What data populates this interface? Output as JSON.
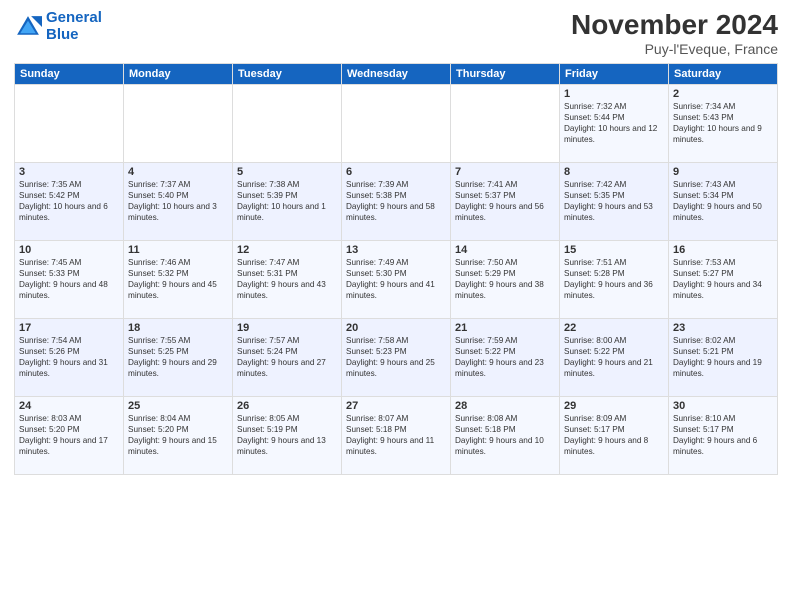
{
  "logo": {
    "line1": "General",
    "line2": "Blue"
  },
  "title": "November 2024",
  "subtitle": "Puy-l'Eveque, France",
  "days_of_week": [
    "Sunday",
    "Monday",
    "Tuesday",
    "Wednesday",
    "Thursday",
    "Friday",
    "Saturday"
  ],
  "weeks": [
    [
      {
        "day": "",
        "detail": ""
      },
      {
        "day": "",
        "detail": ""
      },
      {
        "day": "",
        "detail": ""
      },
      {
        "day": "",
        "detail": ""
      },
      {
        "day": "",
        "detail": ""
      },
      {
        "day": "1",
        "detail": "Sunrise: 7:32 AM\nSunset: 5:44 PM\nDaylight: 10 hours and 12 minutes."
      },
      {
        "day": "2",
        "detail": "Sunrise: 7:34 AM\nSunset: 5:43 PM\nDaylight: 10 hours and 9 minutes."
      }
    ],
    [
      {
        "day": "3",
        "detail": "Sunrise: 7:35 AM\nSunset: 5:42 PM\nDaylight: 10 hours and 6 minutes."
      },
      {
        "day": "4",
        "detail": "Sunrise: 7:37 AM\nSunset: 5:40 PM\nDaylight: 10 hours and 3 minutes."
      },
      {
        "day": "5",
        "detail": "Sunrise: 7:38 AM\nSunset: 5:39 PM\nDaylight: 10 hours and 1 minute."
      },
      {
        "day": "6",
        "detail": "Sunrise: 7:39 AM\nSunset: 5:38 PM\nDaylight: 9 hours and 58 minutes."
      },
      {
        "day": "7",
        "detail": "Sunrise: 7:41 AM\nSunset: 5:37 PM\nDaylight: 9 hours and 56 minutes."
      },
      {
        "day": "8",
        "detail": "Sunrise: 7:42 AM\nSunset: 5:35 PM\nDaylight: 9 hours and 53 minutes."
      },
      {
        "day": "9",
        "detail": "Sunrise: 7:43 AM\nSunset: 5:34 PM\nDaylight: 9 hours and 50 minutes."
      }
    ],
    [
      {
        "day": "10",
        "detail": "Sunrise: 7:45 AM\nSunset: 5:33 PM\nDaylight: 9 hours and 48 minutes."
      },
      {
        "day": "11",
        "detail": "Sunrise: 7:46 AM\nSunset: 5:32 PM\nDaylight: 9 hours and 45 minutes."
      },
      {
        "day": "12",
        "detail": "Sunrise: 7:47 AM\nSunset: 5:31 PM\nDaylight: 9 hours and 43 minutes."
      },
      {
        "day": "13",
        "detail": "Sunrise: 7:49 AM\nSunset: 5:30 PM\nDaylight: 9 hours and 41 minutes."
      },
      {
        "day": "14",
        "detail": "Sunrise: 7:50 AM\nSunset: 5:29 PM\nDaylight: 9 hours and 38 minutes."
      },
      {
        "day": "15",
        "detail": "Sunrise: 7:51 AM\nSunset: 5:28 PM\nDaylight: 9 hours and 36 minutes."
      },
      {
        "day": "16",
        "detail": "Sunrise: 7:53 AM\nSunset: 5:27 PM\nDaylight: 9 hours and 34 minutes."
      }
    ],
    [
      {
        "day": "17",
        "detail": "Sunrise: 7:54 AM\nSunset: 5:26 PM\nDaylight: 9 hours and 31 minutes."
      },
      {
        "day": "18",
        "detail": "Sunrise: 7:55 AM\nSunset: 5:25 PM\nDaylight: 9 hours and 29 minutes."
      },
      {
        "day": "19",
        "detail": "Sunrise: 7:57 AM\nSunset: 5:24 PM\nDaylight: 9 hours and 27 minutes."
      },
      {
        "day": "20",
        "detail": "Sunrise: 7:58 AM\nSunset: 5:23 PM\nDaylight: 9 hours and 25 minutes."
      },
      {
        "day": "21",
        "detail": "Sunrise: 7:59 AM\nSunset: 5:22 PM\nDaylight: 9 hours and 23 minutes."
      },
      {
        "day": "22",
        "detail": "Sunrise: 8:00 AM\nSunset: 5:22 PM\nDaylight: 9 hours and 21 minutes."
      },
      {
        "day": "23",
        "detail": "Sunrise: 8:02 AM\nSunset: 5:21 PM\nDaylight: 9 hours and 19 minutes."
      }
    ],
    [
      {
        "day": "24",
        "detail": "Sunrise: 8:03 AM\nSunset: 5:20 PM\nDaylight: 9 hours and 17 minutes."
      },
      {
        "day": "25",
        "detail": "Sunrise: 8:04 AM\nSunset: 5:20 PM\nDaylight: 9 hours and 15 minutes."
      },
      {
        "day": "26",
        "detail": "Sunrise: 8:05 AM\nSunset: 5:19 PM\nDaylight: 9 hours and 13 minutes."
      },
      {
        "day": "27",
        "detail": "Sunrise: 8:07 AM\nSunset: 5:18 PM\nDaylight: 9 hours and 11 minutes."
      },
      {
        "day": "28",
        "detail": "Sunrise: 8:08 AM\nSunset: 5:18 PM\nDaylight: 9 hours and 10 minutes."
      },
      {
        "day": "29",
        "detail": "Sunrise: 8:09 AM\nSunset: 5:17 PM\nDaylight: 9 hours and 8 minutes."
      },
      {
        "day": "30",
        "detail": "Sunrise: 8:10 AM\nSunset: 5:17 PM\nDaylight: 9 hours and 6 minutes."
      }
    ]
  ]
}
